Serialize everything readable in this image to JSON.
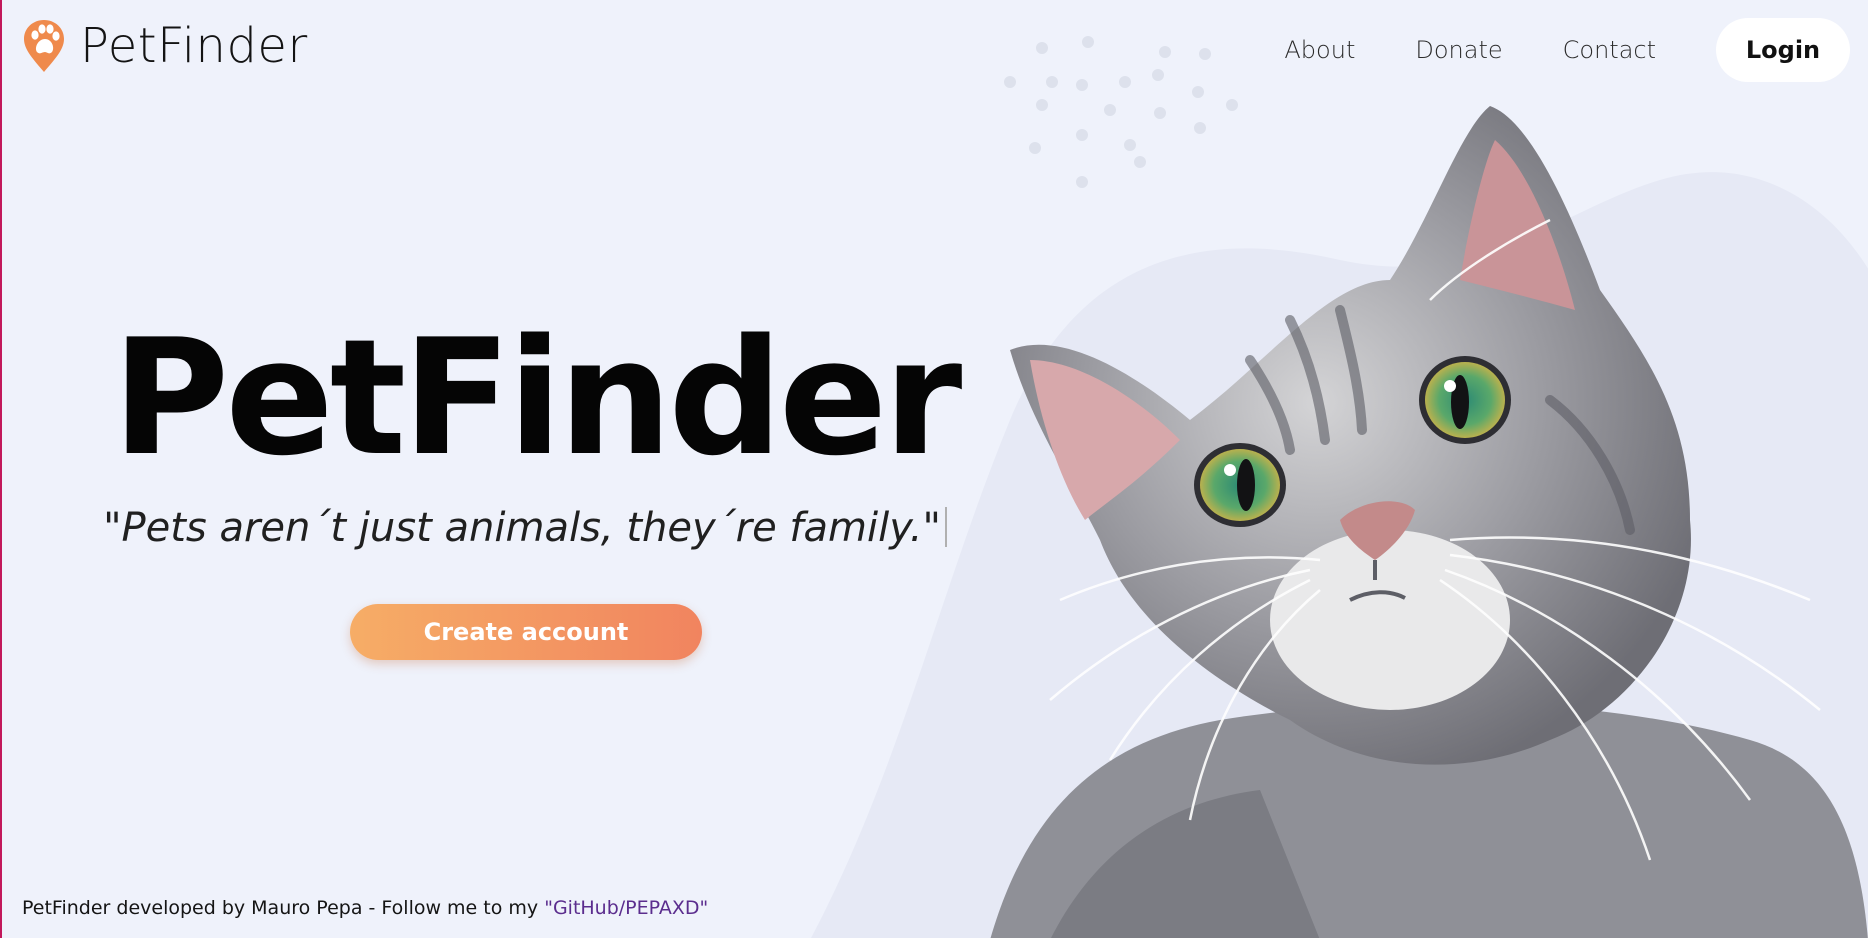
{
  "header": {
    "logo_text": "PetFinder",
    "nav": {
      "about": "About",
      "donate": "Donate",
      "contact": "Contact"
    },
    "login_label": "Login"
  },
  "hero": {
    "title": "PetFinder",
    "tagline": "\"Pets aren´t just animals, they´re family.\"",
    "cta_label": "Create account"
  },
  "footer": {
    "text": "PetFinder developed by Mauro Pepa - Follow me to my ",
    "link_text": "\"GitHub/PEPAXD\""
  },
  "colors": {
    "background": "#eff2fb",
    "logo_orange": "#ef8a4c",
    "cta_gradient_start": "#f6ad66",
    "cta_gradient_end": "#f1845f",
    "footer_link": "#5b2d8e"
  },
  "icons": {
    "logo": "paw-pin-icon",
    "cursor": "text-caret"
  }
}
